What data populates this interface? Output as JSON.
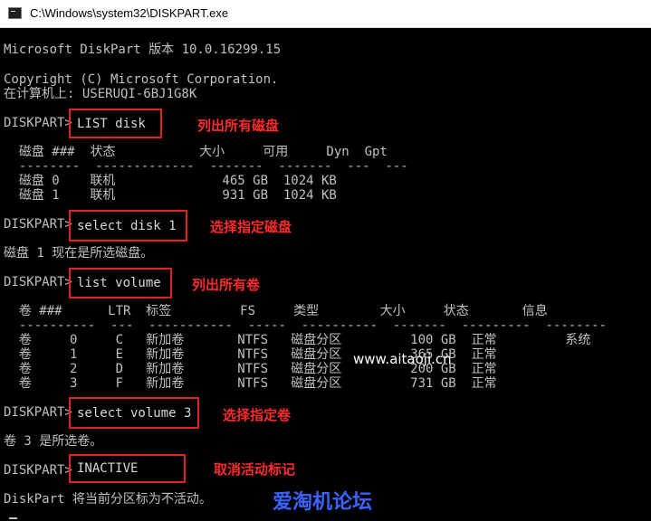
{
  "window": {
    "title": "C:\\Windows\\system32\\DISKPART.exe"
  },
  "console": {
    "lines": [
      "Microsoft DiskPart 版本 10.0.16299.15",
      "Copyright (C) Microsoft Corporation.",
      "在计算机上: USERUQI-6BJ1G8K",
      "DISKPART>",
      "  磁盘 ###  状态           大小     可用     Dyn  Gpt",
      "  --------  -------------  -------  -------  ---  ---",
      "  磁盘 0    联机              465 GB  1024 KB",
      "  磁盘 1    联机              931 GB  1024 KB",
      "DISKPART>",
      "磁盘 1 现在是所选磁盘。",
      "DISKPART>",
      "  卷 ###      LTR  标签         FS     类型        大小     状态       信息",
      "  ----------  ---  -----------  -----  ----------  -------  ---------  --------",
      "  卷     0     C   新加卷       NTFS   磁盘分区         100 GB  正常         系统",
      "  卷     1     E   新加卷       NTFS   磁盘分区         365 GB  正常",
      "  卷     2     D   新加卷       NTFS   磁盘分区         200 GB  正常",
      "  卷     3     F   新加卷       NTFS   磁盘分区         731 GB  正常",
      "DISKPART>",
      "卷 3 是所选卷。",
      "DISKPART>",
      "DiskPart 将当前分区标为不活动。"
    ],
    "commands": {
      "list_disk": "LIST disk",
      "select_disk": "select disk 1",
      "list_volume": "list volume",
      "select_volume": "select volume 3",
      "inactive": "INACTIVE"
    }
  },
  "annotations": {
    "list_disk": "列出所有磁盘",
    "select_disk": "选择指定磁盘",
    "list_volume": "列出所有卷",
    "select_volume": "选择指定卷",
    "inactive": "取消活动标记"
  },
  "watermarks": {
    "url": "www.aitaoji.cn",
    "site": "爱淘机论坛"
  },
  "colors": {
    "console_bg": "#000000",
    "console_text": "#c0c0c0",
    "highlight_box": "#e0241a",
    "annotation_text": "#ff2a2a",
    "site_watermark": "#3b63ff"
  }
}
